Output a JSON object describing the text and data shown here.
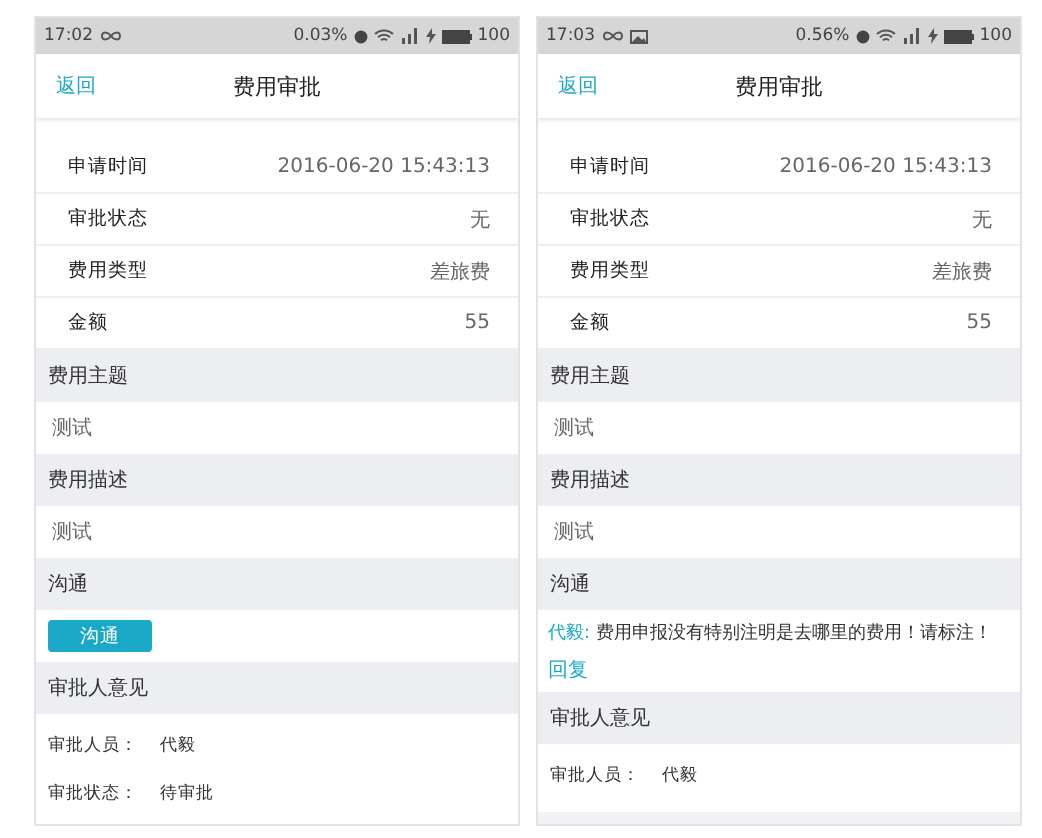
{
  "phones": [
    {
      "status_bar": {
        "time": "17:02",
        "data_rate": "0.03%",
        "battery": "100",
        "left_icons": [
          {
            "kind": "infinity"
          }
        ]
      },
      "header": {
        "back": "返回",
        "title": "费用审批"
      },
      "detail_rows": [
        {
          "label": "申请时间",
          "value": "2016-06-20 15:43:13"
        },
        {
          "label": "审批状态",
          "value": "无"
        },
        {
          "label": "费用类型",
          "value": "差旅费"
        },
        {
          "label": "金额",
          "value": "55"
        }
      ],
      "sections": [
        {
          "title": "费用主题",
          "kind": "text",
          "text": "测试"
        },
        {
          "title": "费用描述",
          "kind": "text",
          "text": "测试"
        },
        {
          "title": "沟通",
          "kind": "button",
          "button": "沟通"
        },
        {
          "title": "审批人意见",
          "kind": "fields",
          "fields": [
            {
              "label": "审批人员：",
              "value": "代毅"
            },
            {
              "label": "审批状态：",
              "value": "待审批"
            }
          ]
        }
      ]
    },
    {
      "status_bar": {
        "time": "17:03",
        "data_rate": "0.56%",
        "battery": "100",
        "left_icons": [
          {
            "kind": "infinity"
          },
          {
            "kind": "image"
          }
        ]
      },
      "header": {
        "back": "返回",
        "title": "费用审批"
      },
      "detail_rows": [
        {
          "label": "申请时间",
          "value": "2016-06-20 15:43:13"
        },
        {
          "label": "审批状态",
          "value": "无"
        },
        {
          "label": "费用类型",
          "value": "差旅费"
        },
        {
          "label": "金额",
          "value": "55"
        }
      ],
      "sections": [
        {
          "title": "费用主题",
          "kind": "text",
          "text": "测试"
        },
        {
          "title": "费用描述",
          "kind": "text",
          "text": "测试"
        },
        {
          "title": "沟通",
          "kind": "messages",
          "messages": [
            {
              "author": "代毅:",
              "text": "费用申报没有特别注明是去哪里的费用！请标注！"
            }
          ],
          "reply": "回复"
        },
        {
          "title": "审批人意见",
          "kind": "fields",
          "fields": [
            {
              "label": "审批人员：",
              "value": "代毅"
            }
          ]
        }
      ]
    }
  ]
}
